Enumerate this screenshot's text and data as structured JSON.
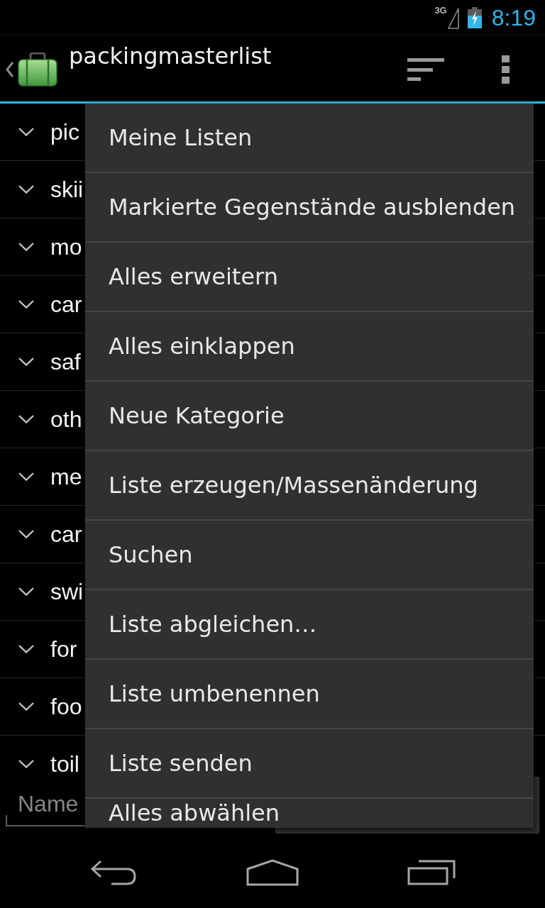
{
  "status_bar": {
    "network": "3G",
    "time": "8:19"
  },
  "action_bar": {
    "title": "packingmasterlist"
  },
  "categories": [
    {
      "label": "pic",
      "expanded": false
    },
    {
      "label": "skii",
      "expanded": false
    },
    {
      "label": "mo",
      "expanded": false
    },
    {
      "label": "car",
      "expanded": false
    },
    {
      "label": "saf",
      "expanded": false
    },
    {
      "label": "oth",
      "expanded": false
    },
    {
      "label": "me",
      "expanded": false
    },
    {
      "label": "car",
      "expanded": false
    },
    {
      "label": "swi",
      "expanded": false
    },
    {
      "label": "for",
      "expanded": false
    },
    {
      "label": "foo",
      "expanded": false
    },
    {
      "label": "toil",
      "expanded": false
    }
  ],
  "new_item": {
    "placeholder": "Name"
  },
  "overflow_menu": {
    "items": [
      {
        "label": "Meine Listen"
      },
      {
        "label": "Markierte Gegenstände ausblenden"
      },
      {
        "label": "Alles erweitern"
      },
      {
        "label": "Alles einklappen"
      },
      {
        "label": "Neue Kategorie"
      },
      {
        "label": "Liste erzeugen/Massenänderung"
      },
      {
        "label": "Suchen"
      },
      {
        "label": "Liste abgleichen…"
      },
      {
        "label": "Liste umbenennen"
      },
      {
        "label": "Liste senden"
      },
      {
        "label": "Alles abwählen"
      }
    ]
  }
}
